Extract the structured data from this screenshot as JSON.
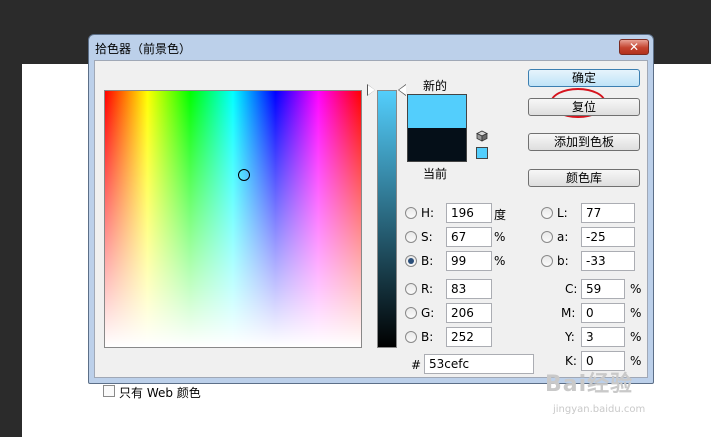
{
  "dialog": {
    "title": "拾色器（前景色）",
    "close_label": "✕"
  },
  "color": {
    "new_label": "新的",
    "current_label": "当前",
    "new_hex": "#53cefc",
    "current_hex": "#050f18"
  },
  "buttons": {
    "ok": "确定",
    "reset": "复位",
    "add_to_swatches": "添加到色板",
    "color_libraries": "颜色库"
  },
  "hsb": {
    "h_label": "H:",
    "h_value": "196",
    "h_unit": "度",
    "s_label": "S:",
    "s_value": "67",
    "s_unit": "%",
    "b_label": "B:",
    "b_value": "99",
    "b_unit": "%"
  },
  "rgb": {
    "r_label": "R:",
    "r_value": "83",
    "g_label": "G:",
    "g_value": "206",
    "b_label": "B:",
    "b_value": "252"
  },
  "lab": {
    "l_label": "L:",
    "l_value": "77",
    "a_label": "a:",
    "a_value": "-25",
    "b_label": "b:",
    "b_value": "-33"
  },
  "cmyk": {
    "c_label": "C:",
    "c_value": "59",
    "c_unit": "%",
    "m_label": "M:",
    "m_value": "0",
    "m_unit": "%",
    "y_label": "Y:",
    "y_value": "3",
    "y_unit": "%",
    "k_label": "K:",
    "k_value": "0",
    "k_unit": "%"
  },
  "hex": {
    "label": "#",
    "value": "53cefc"
  },
  "web_only": {
    "label": "只有 Web 颜色",
    "checked": false
  },
  "watermark": {
    "main": "Bai经验",
    "sub": "jingyan.baidu.com"
  }
}
